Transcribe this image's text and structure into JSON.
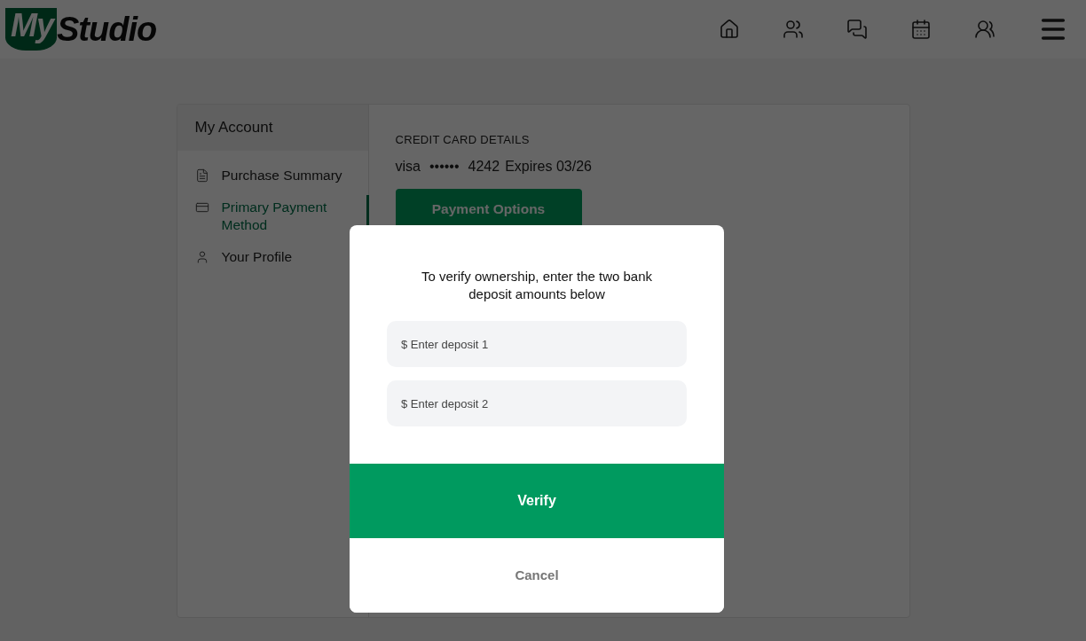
{
  "logo": {
    "first": "My",
    "second": "Studio"
  },
  "sidebar": {
    "title": "My Account",
    "items": [
      {
        "label": "Purchase Summary",
        "selected": false
      },
      {
        "label": "Primary Payment Method",
        "selected": true
      },
      {
        "label": "Your Profile",
        "selected": false
      }
    ]
  },
  "card_details": {
    "heading": "CREDIT CARD DETAILS",
    "brand": "visa",
    "mask": "••••••",
    "last4": "4242",
    "expiry": "Expires 03/26",
    "button": "Payment Options"
  },
  "dialog": {
    "message": "To verify ownership, enter the two bank deposit amounts below",
    "fields": [
      {
        "placeholder": "$ Enter deposit 1"
      },
      {
        "placeholder": "$ Enter deposit 2"
      }
    ],
    "confirm": "Verify",
    "cancel": "Cancel"
  }
}
